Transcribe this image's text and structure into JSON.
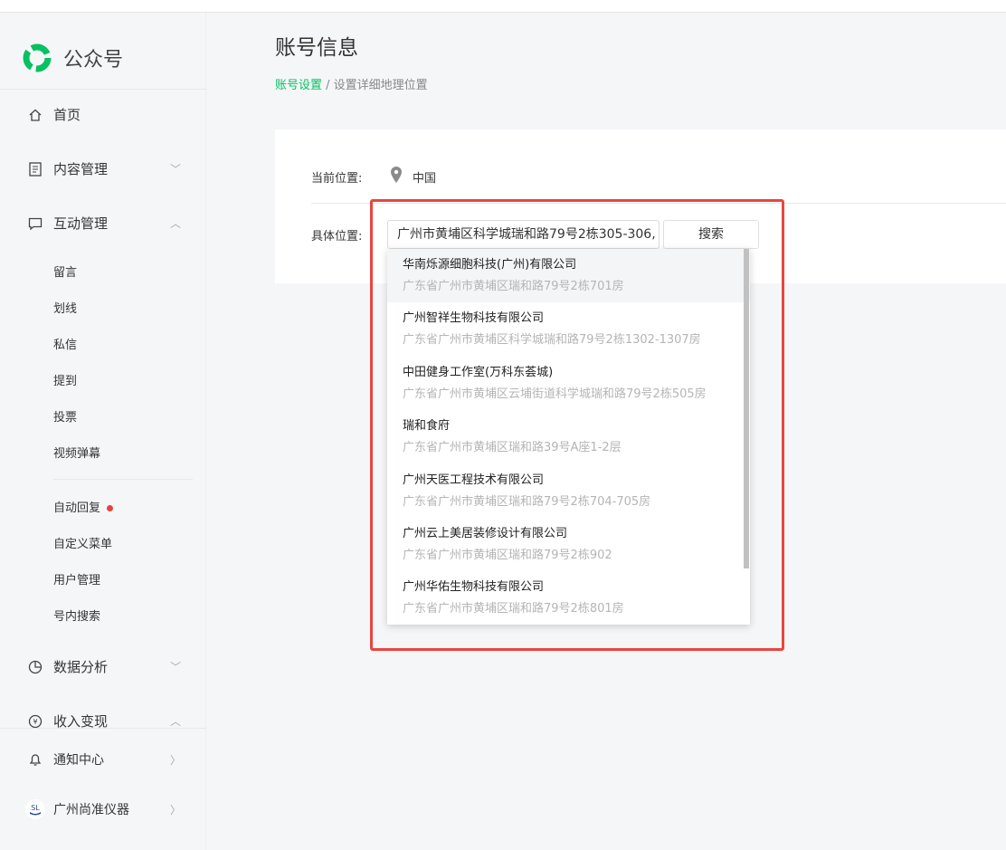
{
  "sidebar": {
    "brand": "公众号",
    "items": [
      {
        "label": "首页",
        "icon": "home-icon"
      },
      {
        "label": "内容管理",
        "icon": "document-icon"
      },
      {
        "label": "互动管理",
        "icon": "chat-icon"
      },
      {
        "label": "数据分析",
        "icon": "pie-chart-icon"
      },
      {
        "label": "收入变现",
        "icon": "yen-icon"
      }
    ],
    "sub_items": [
      "留言",
      "划线",
      "私信",
      "提到",
      "投票",
      "视频弹幕",
      "自动回复",
      "自定义菜单",
      "用户管理",
      "号内搜索"
    ],
    "notify": "通知中心",
    "account": "广州尚准仪器"
  },
  "page": {
    "title": "账号信息",
    "breadcrumb_link": "账号设置",
    "breadcrumb_sep": " / ",
    "breadcrumb_current": "设置详细地理位置",
    "current_label": "当前位置:",
    "current_value": "中国",
    "detail_label": "具体位置:",
    "input_value": "广州市黄埔区科学城瑞和路79号2栋305-306,",
    "search_label": "搜索"
  },
  "suggestions": [
    {
      "name": "华南烁源细胞科技(广州)有限公司",
      "addr": "广东省广州市黄埔区瑞和路79号2栋701房"
    },
    {
      "name": "广州智祥生物科技有限公司",
      "addr": "广东省广州市黄埔区科学城瑞和路79号2栋1302-1307房"
    },
    {
      "name": "中田健身工作室(万科东荟城)",
      "addr": "广东省广州市黄埔区云埔街道科学城瑞和路79号2栋505房"
    },
    {
      "name": "瑞和食府",
      "addr": "广东省广州市黄埔区瑞和路39号A座1-2层"
    },
    {
      "name": "广州天医工程技术有限公司",
      "addr": "广东省广州市黄埔区瑞和路79号2栋704-705房"
    },
    {
      "name": "广州云上美居装修设计有限公司",
      "addr": "广东省广州市黄埔区瑞和路79号2栋902"
    },
    {
      "name": "广州华佑生物科技有限公司",
      "addr": "广东省广州市黄埔区瑞和路79号2栋801房"
    }
  ],
  "colors": {
    "brand": "#07c160",
    "highlight": "#e8463f"
  }
}
